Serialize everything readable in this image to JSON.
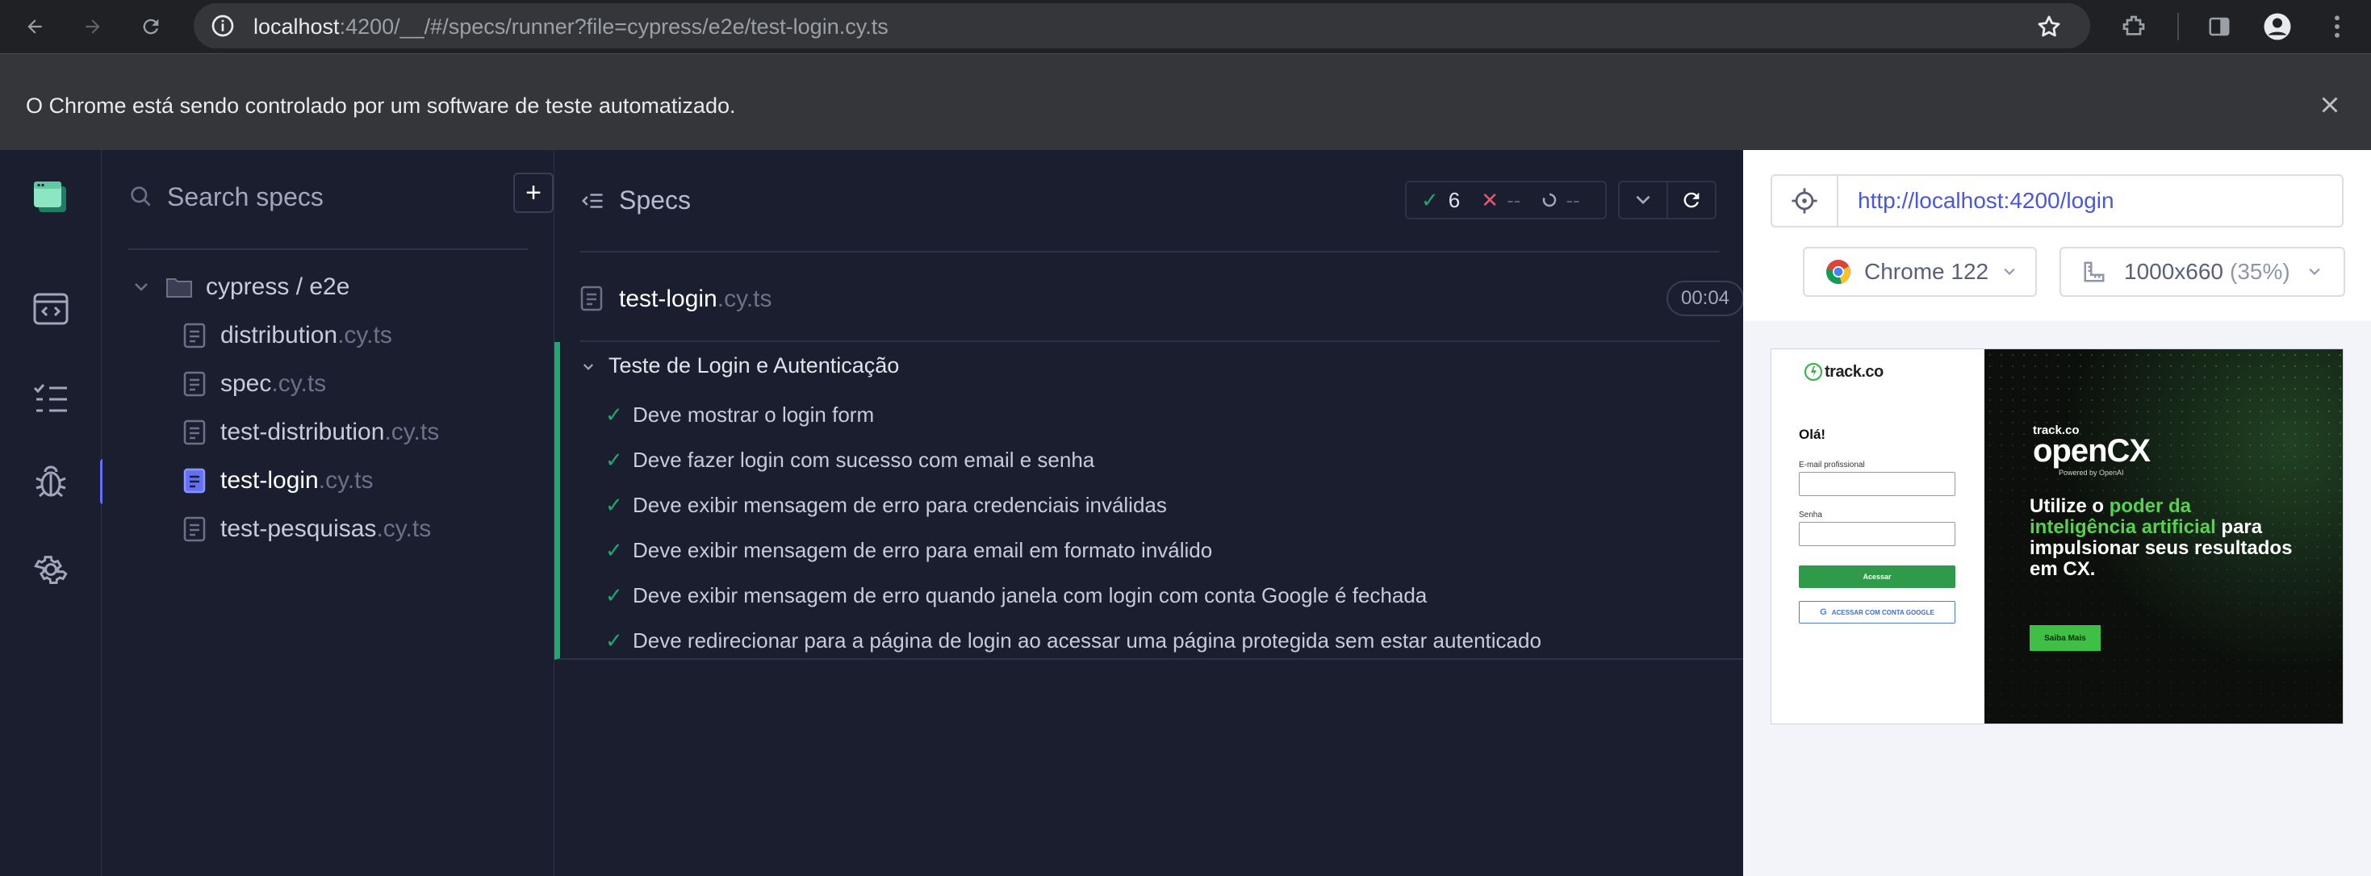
{
  "browser": {
    "url_host": "localhost",
    "url_rest": ":4200/__/#/specs/runner?file=cypress/e2e/test-login.cy.ts",
    "infobar_message": "O Chrome está sendo controlado por um software de teste automatizado."
  },
  "specs_panel": {
    "search_placeholder": "Search specs",
    "add_label": "+",
    "folder": "cypress / e2e",
    "files": [
      {
        "name": "distribution",
        "ext": ".cy.ts"
      },
      {
        "name": "spec",
        "ext": ".cy.ts"
      },
      {
        "name": "test-distribution",
        "ext": ".cy.ts"
      },
      {
        "name": "test-login",
        "ext": ".cy.ts"
      },
      {
        "name": "test-pesquisas",
        "ext": ".cy.ts"
      }
    ]
  },
  "reporter": {
    "header": "Specs",
    "stats": {
      "passed": "6",
      "failed": "--",
      "pending": "--"
    },
    "spec_name": "test-login",
    "spec_ext": ".cy.ts",
    "duration": "00:04",
    "suite_title": "Teste de Login e Autenticação",
    "tests": [
      "Deve mostrar o login form",
      "Deve fazer login com sucesso com email e senha",
      "Deve exibir mensagem de erro para credenciais inválidas",
      "Deve exibir mensagem de erro para email em formato inválido",
      "Deve exibir mensagem de erro quando janela com login com conta Google é fechada",
      "Deve redirecionar para a página de login ao acessar uma página protegida sem estar autenticado"
    ]
  },
  "aut": {
    "url": "http://localhost:4200/login",
    "browser_label": "Chrome 122",
    "viewport": "1000x660",
    "viewport_scale": "(35%)",
    "app": {
      "logo": "track.co",
      "greeting": "Olá!",
      "email_label": "E-mail profissional",
      "password_label": "Senha",
      "submit_label": "Acessar",
      "google_label": "ACESSAR COM CONTA GOOGLE",
      "promo_brand_small": "track.co",
      "promo_brand": "openCX",
      "promo_powered": "Powered by OpenAI",
      "promo_headline_1": "Utilize o ",
      "promo_headline_highlight": "poder da inteligência artificial",
      "promo_headline_2": " para impulsionar seus resultados em CX.",
      "promo_button": "Saiba Mais"
    }
  },
  "colors": {
    "accent": "#6470f3",
    "pass": "#1fa971",
    "fail": "#e45770"
  }
}
